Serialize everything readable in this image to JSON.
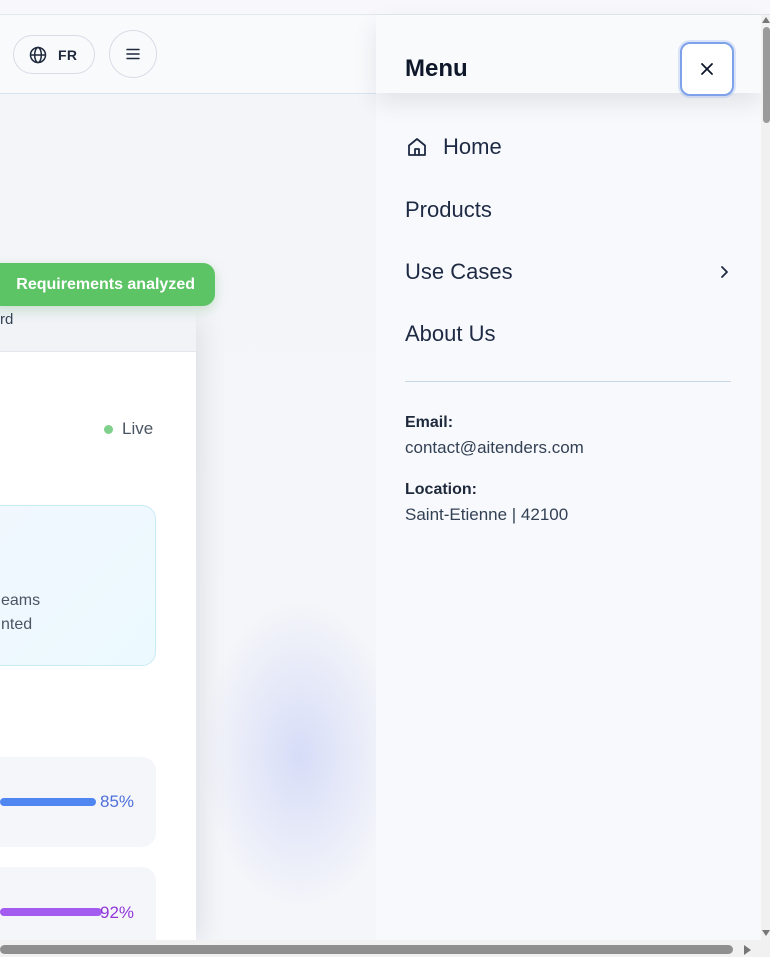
{
  "header": {
    "language": {
      "code": "FR",
      "icon": "globe-icon"
    },
    "menu_button": {
      "icon": "hamburger-icon"
    }
  },
  "background": {
    "toast": "Requirements analyzed",
    "card_header_fragment": "rd",
    "live_label": "Live",
    "info_line_1": "eams",
    "info_line_2": "nted",
    "metrics": [
      {
        "percent_label": "85%",
        "fill_fraction": 0.85,
        "color": "#4f86ef"
      },
      {
        "percent_label": "92%",
        "fill_fraction": 0.92,
        "color": "#a45bef"
      }
    ],
    "colors": {
      "toast_green": "#5dc466",
      "live_dot": "#7fd08a"
    }
  },
  "drawer": {
    "title": "Menu",
    "close_icon": "close-icon",
    "nav": [
      {
        "label": "Home",
        "icon": "home-icon"
      },
      {
        "label": "Products"
      },
      {
        "label": "Use Cases",
        "icon": "chevron-right-icon"
      },
      {
        "label": "About Us"
      }
    ],
    "contact": {
      "email_label": "Email:",
      "email_value": "contact@aitenders.com",
      "location_label": "Location:",
      "location_value": "Saint-Etienne | 42100"
    },
    "colors": {
      "close_focus_ring": "#7ea2ea"
    }
  }
}
